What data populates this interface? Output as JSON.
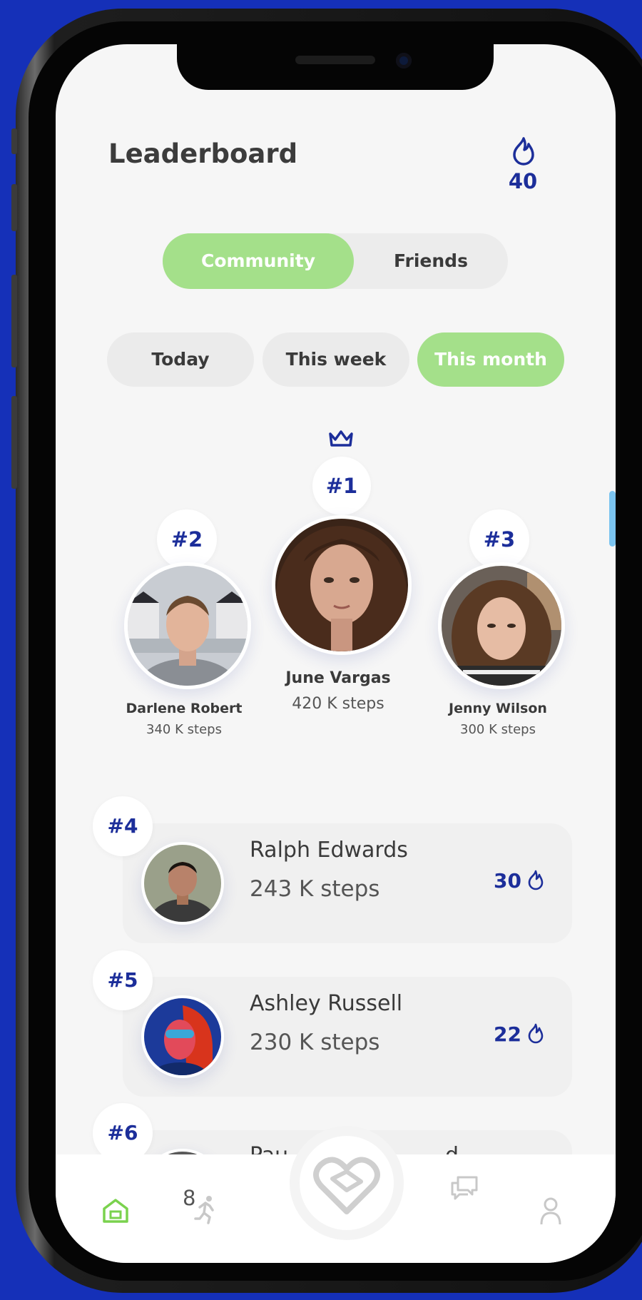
{
  "header": {
    "title": "Leaderboard",
    "streak_value": "40"
  },
  "scope_toggle": {
    "options": [
      "Community",
      "Friends"
    ],
    "selected": "Community"
  },
  "period_filter": {
    "options": [
      "Today",
      "This week",
      "This month"
    ],
    "selected": "This month"
  },
  "podium": [
    {
      "rank": "#1",
      "name": "June Vargas",
      "steps": "420 K steps"
    },
    {
      "rank": "#2",
      "name": "Darlene Robert",
      "steps": "340 K steps"
    },
    {
      "rank": "#3",
      "name": "Jenny Wilson",
      "steps": "300 K steps"
    }
  ],
  "ranking_list": [
    {
      "rank": "#4",
      "name": "Ralph Edwards",
      "steps": "243 K steps",
      "score": "30"
    },
    {
      "rank": "#5",
      "name": "Ashley Russell",
      "steps": "230 K steps",
      "score": "22"
    },
    {
      "rank": "#6",
      "name_left": "Pau",
      "name_right": "d",
      "steps_partial": "8"
    }
  ],
  "bottom_nav": [
    "home-icon",
    "run-icon",
    "heart-icon",
    "chat-icon",
    "profile-icon"
  ],
  "colors": {
    "accent_green": "#a4e08a",
    "brand_blue": "#1c2e9a",
    "background_blue": "#1530b8"
  }
}
